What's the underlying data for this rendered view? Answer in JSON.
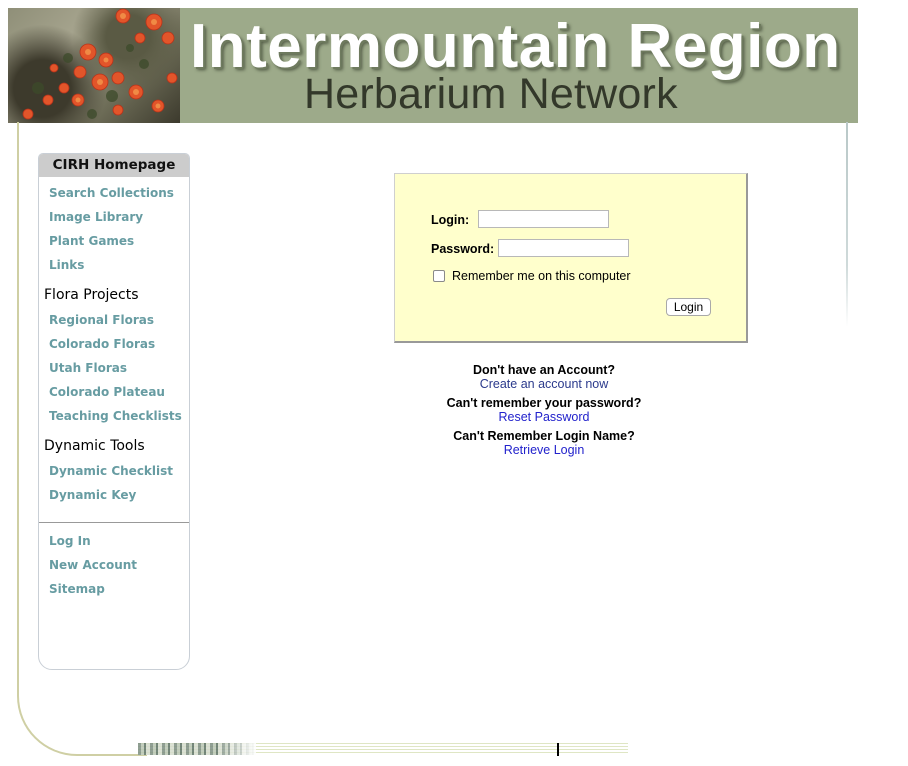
{
  "banner": {
    "title": "Intermountain Region",
    "subtitle": "Herbarium Network"
  },
  "sidebar": {
    "header": "CIRH Homepage",
    "links_main": [
      "Search Collections",
      "Image Library",
      "Plant Games",
      "Links"
    ],
    "flora_section": "Flora Projects",
    "flora_links": [
      "Regional Floras",
      "Colorado Floras",
      "Utah Floras",
      "Colorado Plateau",
      "Teaching Checklists"
    ],
    "tools_section": "Dynamic Tools",
    "tools_links": [
      "Dynamic Checklist",
      "Dynamic Key"
    ],
    "account_links": [
      "Log In",
      "New Account",
      "Sitemap"
    ],
    "link_color": "#679ca2"
  },
  "login": {
    "login_label": "Login:",
    "login_value": "",
    "password_label": "Password:",
    "password_value": "",
    "remember_label": "Remember me on this computer",
    "remember_checked": false,
    "button_label": "Login",
    "box_color": "#ffffcc"
  },
  "help": {
    "no_account_question": "Don't have an Account?",
    "create_account_link": "Create an account now",
    "forgot_password_question": "Can't remember your password?",
    "reset_password_link": "Reset Password",
    "forgot_login_question": "Can't Remember Login Name?",
    "retrieve_login_link": "Retrieve Login"
  }
}
